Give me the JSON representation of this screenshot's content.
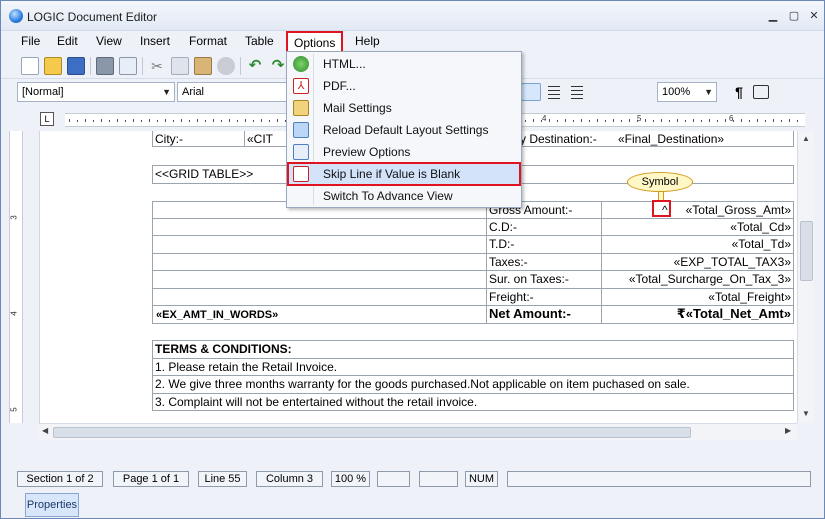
{
  "window": {
    "title": "LOGIC Document Editor"
  },
  "menubar": [
    "File",
    "Edit",
    "View",
    "Insert",
    "Format",
    "Table",
    "Options",
    "Help"
  ],
  "toolbar2": {
    "style_combo": "[Normal]",
    "font_combo": "Arial",
    "zoom_combo": "100%"
  },
  "ruler": {
    "numbers": [
      "1",
      "2",
      "3",
      "4",
      "5",
      "6"
    ]
  },
  "vruler": {
    "numbers": [
      "2",
      "3",
      "4",
      "5"
    ]
  },
  "options_menu": {
    "items": [
      {
        "label": "HTML...",
        "icon": "html-globe-icon"
      },
      {
        "label": "PDF...",
        "icon": "pdf-icon"
      },
      {
        "label": "Mail Settings",
        "icon": "mail-icon"
      },
      {
        "label": "Reload Default Layout Settings",
        "icon": "reload-layout-icon"
      },
      {
        "label": "Preview Options",
        "icon": "preview-icon"
      },
      {
        "label": "Skip Line if Value is Blank",
        "icon": "skip-line-icon"
      },
      {
        "label": "Switch To Advance View",
        "icon": ""
      }
    ]
  },
  "document": {
    "row_city": {
      "left": "City:-",
      "mid": "«CIT",
      "right_label": "y Destination:-",
      "right_value": "«Final_Destination»"
    },
    "grid_table": "<<GRID TABLE>>",
    "callout": "Symbol",
    "symbol_marker": "^",
    "totals": [
      {
        "label": "Gross Amount:-",
        "value": "«Total_Gross_Amt»"
      },
      {
        "label": "C.D:-",
        "value": "«Total_Cd»"
      },
      {
        "label": "T.D:-",
        "value": "«Total_Td»"
      },
      {
        "label": "Taxes:-",
        "value": "«EXP_TOTAL_TAX3»"
      },
      {
        "label": "Sur. on Taxes:-",
        "value": "«Total_Surcharge_On_Tax_3»"
      },
      {
        "label": "Freight:-",
        "value": "«Total_Freight»"
      }
    ],
    "amount_words": "«EX_AMT_IN_WORDS»",
    "net_amount_label": "Net Amount:-",
    "net_amount_value": "₹«Total_Net_Amt»",
    "terms_title": "TERMS & CONDITIONS:",
    "terms": [
      "1. Please retain the Retail Invoice.",
      "2. We give three months warranty for the goods purchased.Not applicable on item puchased on sale.",
      "3. Complaint will not be entertained without the retail invoice."
    ]
  },
  "statusbar": {
    "section": "Section 1 of 2",
    "page": "Page 1 of 1",
    "line": "Line 55",
    "column": "Column 3",
    "zoom": "100 %",
    "num": "NUM"
  },
  "bottom_tab": "Properties"
}
